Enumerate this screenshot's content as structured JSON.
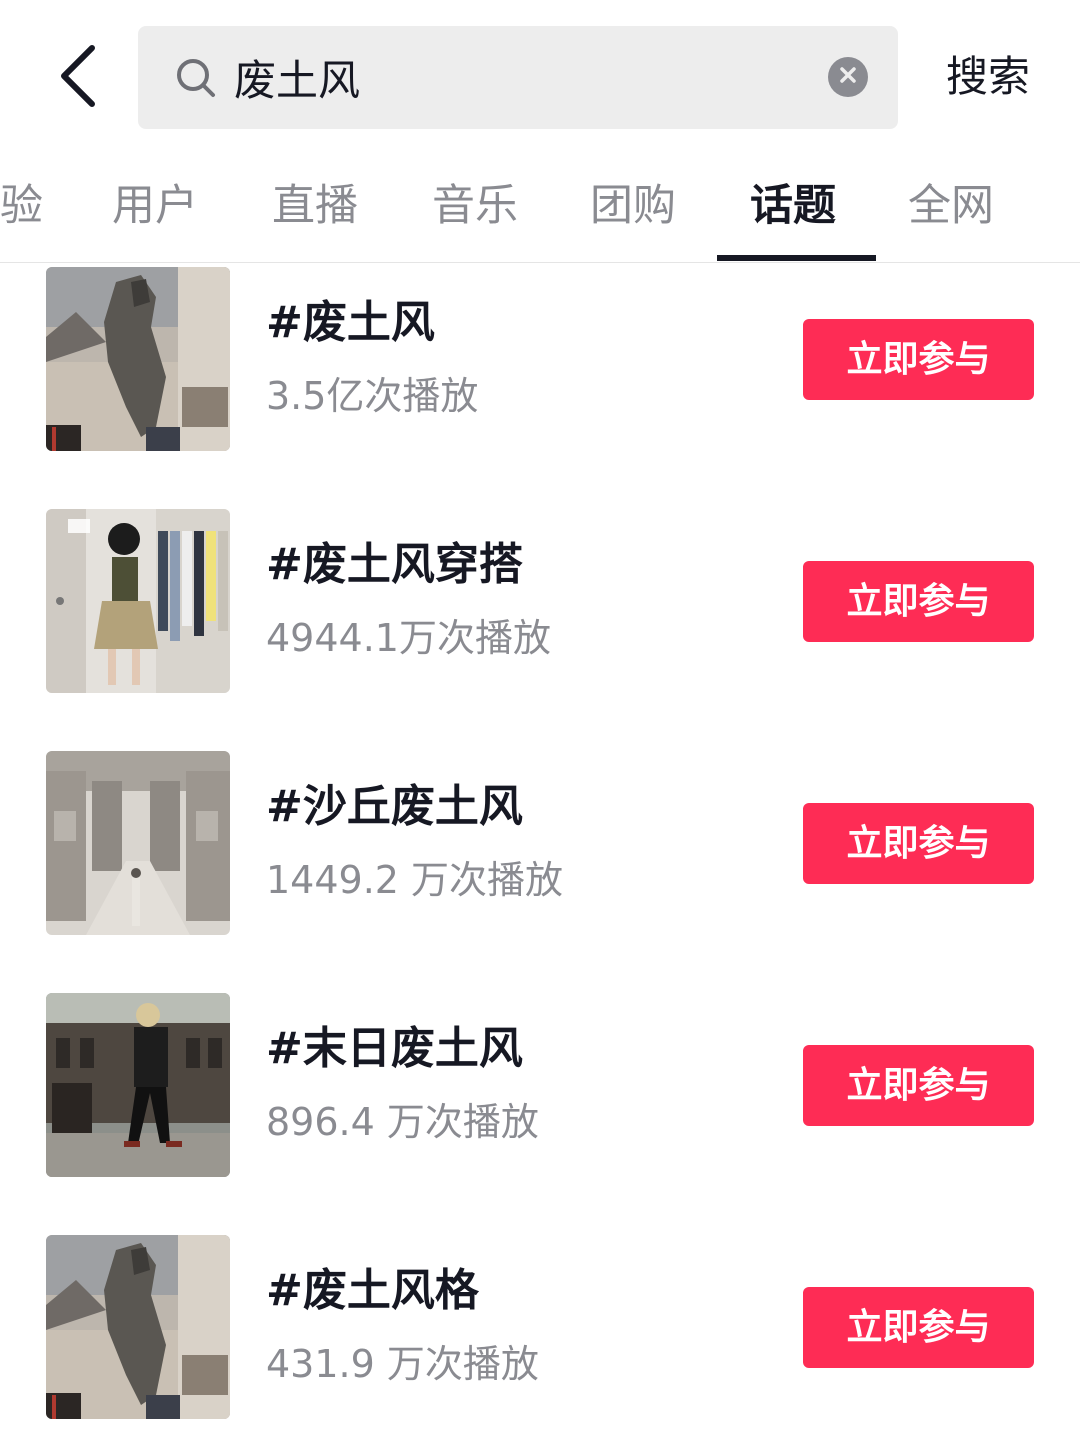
{
  "search": {
    "query": "废土风",
    "button_label": "搜索"
  },
  "tabs": [
    {
      "label": "验"
    },
    {
      "label": "用户"
    },
    {
      "label": "直播"
    },
    {
      "label": "音乐"
    },
    {
      "label": "团购"
    },
    {
      "label": "话题",
      "active": true
    },
    {
      "label": "全网"
    }
  ],
  "topics": [
    {
      "name": "#废土风",
      "plays": "3.5亿次播放",
      "button": "立即参与"
    },
    {
      "name": "#废土风穿搭",
      "plays": "4944.1万次播放",
      "button": "立即参与"
    },
    {
      "name": "#沙丘废土风",
      "plays": "1449.2 万次播放",
      "button": "立即参与"
    },
    {
      "name": "#末日废土风",
      "plays": "896.4 万次播放",
      "button": "立即参与"
    },
    {
      "name": "#废土风格",
      "plays": "431.9 万次播放",
      "button": "立即参与"
    }
  ],
  "colors": {
    "accent": "#fe2c55",
    "text_primary": "#161823",
    "text_secondary": "#8a8b91",
    "search_bg": "#ededed"
  }
}
